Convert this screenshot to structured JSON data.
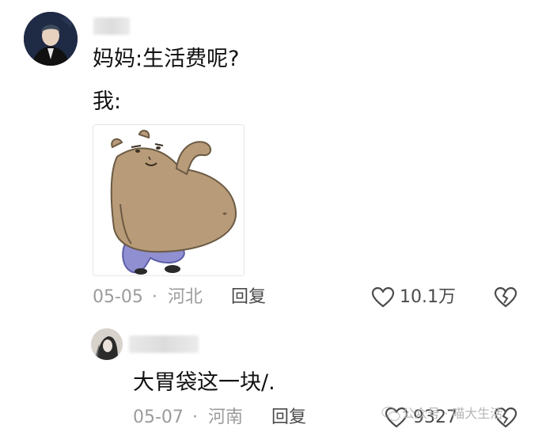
{
  "comment": {
    "text_line1": "妈妈:生活费呢?",
    "text_line2": "我:",
    "date": "05-05",
    "separator": "·",
    "location": "河北",
    "reply_label": "回复",
    "like_count": "10.1万",
    "icons": {
      "like": "heart-outline-icon",
      "dislike": "broken-heart-icon"
    }
  },
  "reply": {
    "text": "大胃袋这一块/.",
    "date": "05-07",
    "separator": "·",
    "location": "河南",
    "reply_label": "回复",
    "like_count": "9327",
    "icons": {
      "like": "heart-outline-icon",
      "dislike": "broken-heart-icon"
    }
  },
  "watermark": {
    "text": "公众号 · 喵大生活",
    "icon": "wechat-icon"
  },
  "colors": {
    "text": "#111111",
    "meta": "#9b9b9b",
    "action": "#4a4a4a",
    "sticker_body": "#b89b78",
    "sticker_pants": "#8f8fd1"
  }
}
